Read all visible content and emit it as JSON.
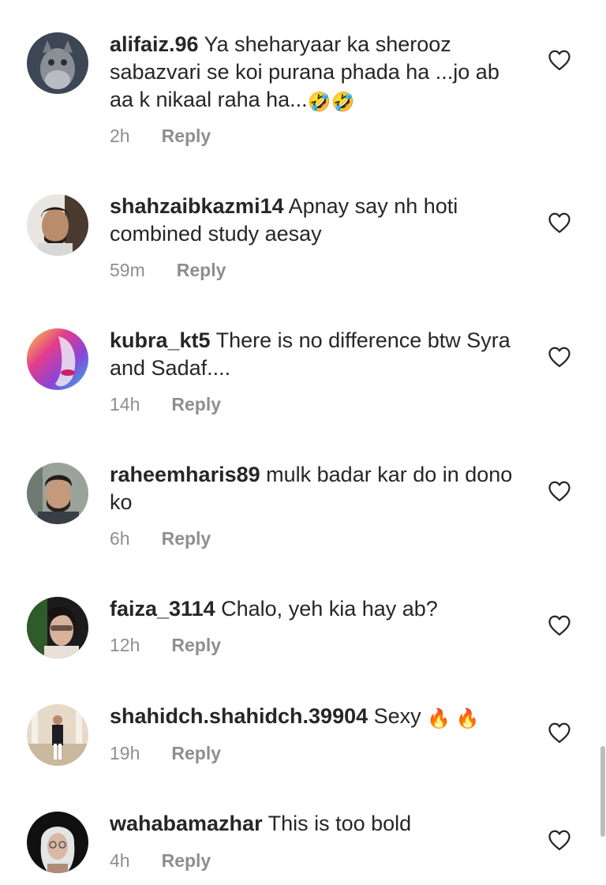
{
  "comments": [
    {
      "username": "alifaiz.96",
      "text": "Ya sheharyaar ka sherooz sabazvari se koi purana phada ha ...jo ab aa k nikaal raha ha...",
      "emoji": "🤣🤣",
      "time": "2h",
      "reply": "Reply"
    },
    {
      "username": "shahzaibkazmi14",
      "text": "Apnay say nh hoti combined study aesay",
      "emoji": "",
      "time": "59m",
      "reply": "Reply"
    },
    {
      "username": "kubra_kt5",
      "text": "There is no difference btw Syra and Sadaf....",
      "emoji": "",
      "time": "14h",
      "reply": "Reply"
    },
    {
      "username": "raheemharis89",
      "text": "mulk badar kar do in dono ko",
      "emoji": "",
      "time": "6h",
      "reply": "Reply"
    },
    {
      "username": "faiza_3114",
      "text": "Chalo, yeh kia hay ab?",
      "emoji": "",
      "time": "12h",
      "reply": "Reply"
    },
    {
      "username": "shahidch.shahidch.39904",
      "text": "Sexy",
      "emoji": "🔥 🔥",
      "time": "19h",
      "reply": "Reply"
    },
    {
      "username": "wahabamazhar",
      "text": "This is too bold",
      "emoji": "",
      "time": "4h",
      "reply": "Reply"
    }
  ],
  "icons": {
    "like": "heart-outline-icon"
  },
  "colors": {
    "text": "#262626",
    "muted": "#8e8e8e",
    "background": "#ffffff"
  }
}
